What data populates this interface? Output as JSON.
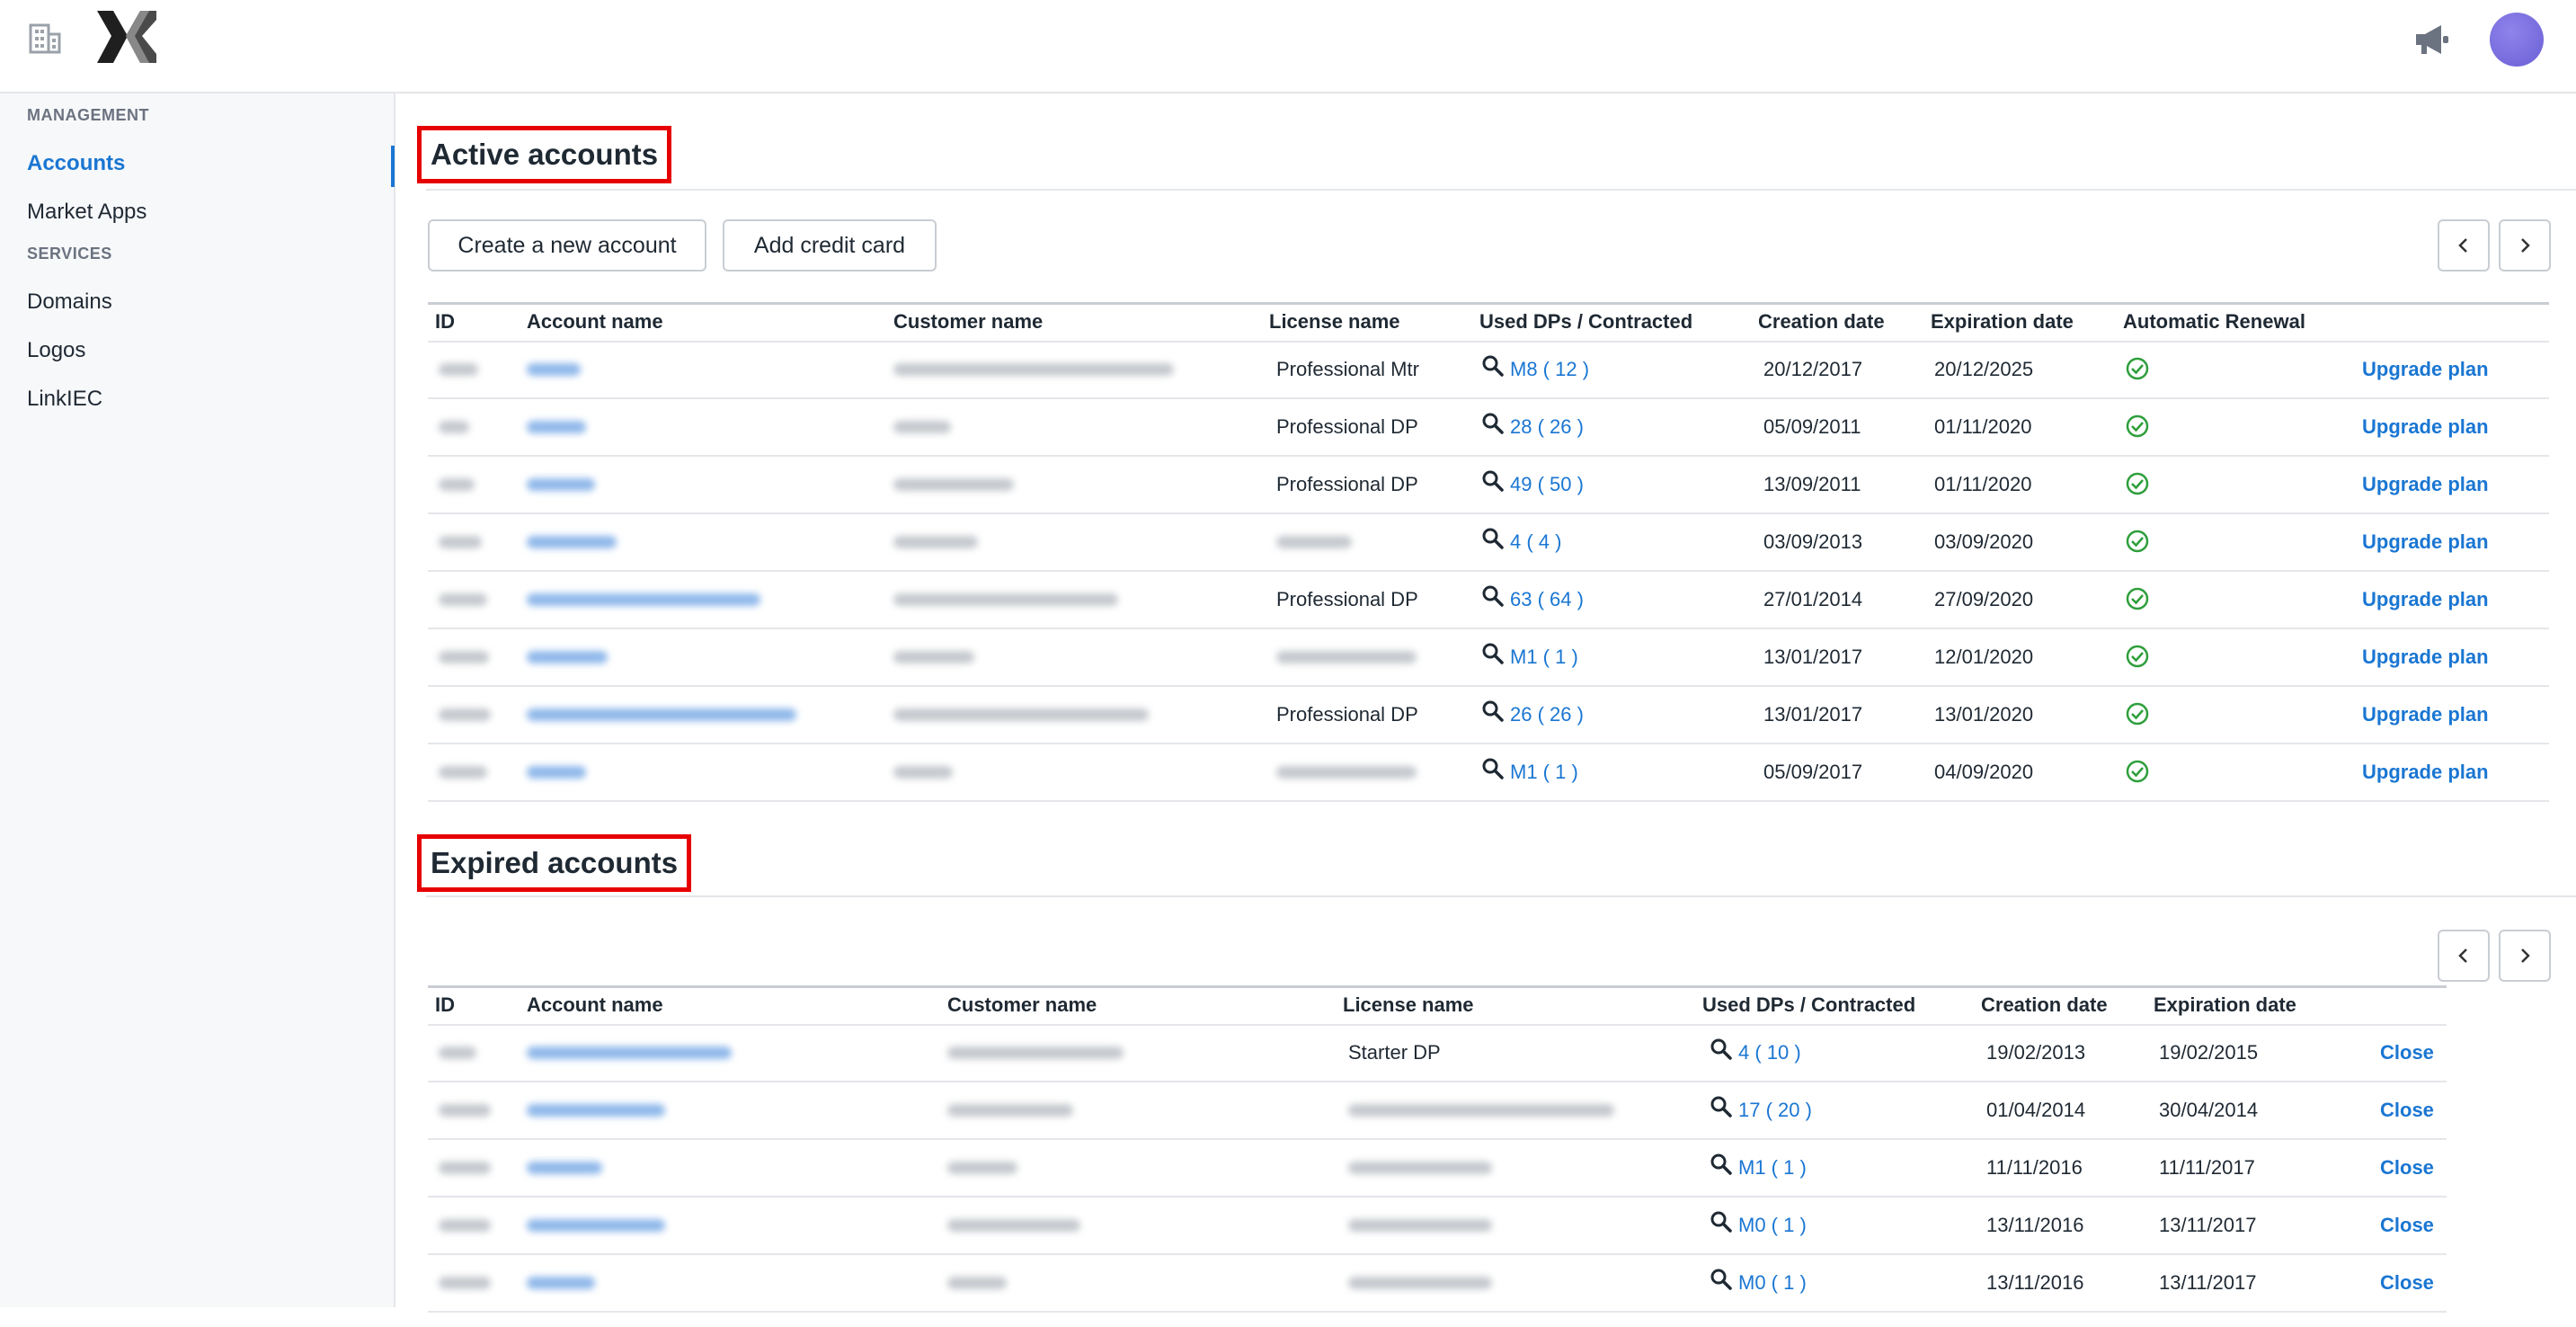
{
  "sidebar": {
    "management_heading": "MANAGEMENT",
    "services_heading": "SERVICES",
    "items": [
      "Accounts",
      "Market Apps",
      "Domains",
      "Logos",
      "LinkIEC"
    ]
  },
  "active": {
    "title": "Active accounts",
    "buttons": {
      "create": "Create a new account",
      "add_card": "Add credit card"
    },
    "headers": [
      "ID",
      "Account name",
      "Customer name",
      "License name",
      "Used DPs / Contracted",
      "Creation date",
      "Expiration date",
      "Automatic Renewal"
    ],
    "rows": [
      {
        "license": "Professional Mtr",
        "used": "M8 ( 12 )",
        "created": "20/12/2017",
        "expires": "20/12/2025",
        "action": "Upgrade plan"
      },
      {
        "license": "Professional DP",
        "used": "28 ( 26 )",
        "created": "05/09/2011",
        "expires": "01/11/2020",
        "action": "Upgrade plan"
      },
      {
        "license": "Professional DP",
        "used": "49 ( 50 )",
        "created": "13/09/2011",
        "expires": "01/11/2020",
        "action": "Upgrade plan"
      },
      {
        "license": "",
        "used": "4 ( 4 )",
        "created": "03/09/2013",
        "expires": "03/09/2020",
        "action": "Upgrade plan"
      },
      {
        "license": "Professional DP",
        "used": "63 ( 64 )",
        "created": "27/01/2014",
        "expires": "27/09/2020",
        "action": "Upgrade plan"
      },
      {
        "license": "",
        "used": "M1 ( 1 )",
        "created": "13/01/2017",
        "expires": "12/01/2020",
        "action": "Upgrade plan"
      },
      {
        "license": "Professional DP",
        "used": "26 ( 26 )",
        "created": "13/01/2017",
        "expires": "13/01/2020",
        "action": "Upgrade plan"
      },
      {
        "license": "",
        "used": "M1 ( 1 )",
        "created": "05/09/2017",
        "expires": "04/09/2020",
        "action": "Upgrade plan"
      }
    ]
  },
  "expired": {
    "title": "Expired accounts",
    "headers": [
      "ID",
      "Account name",
      "Customer name",
      "License name",
      "Used DPs / Contracted",
      "Creation date",
      "Expiration date"
    ],
    "rows": [
      {
        "license": "Starter DP",
        "used": "4 ( 10 )",
        "created": "19/02/2013",
        "expires": "19/02/2015",
        "action": "Close"
      },
      {
        "license": "",
        "used": "17 ( 20 )",
        "created": "01/04/2014",
        "expires": "30/04/2014",
        "action": "Close"
      },
      {
        "license": "",
        "used": "M1 ( 1 )",
        "created": "11/11/2016",
        "expires": "11/11/2017",
        "action": "Close"
      },
      {
        "license": "",
        "used": "M0 ( 1 )",
        "created": "13/11/2016",
        "expires": "13/11/2017",
        "action": "Close"
      },
      {
        "license": "",
        "used": "M0 ( 1 )",
        "created": "13/11/2016",
        "expires": "13/11/2017",
        "action": "Close"
      }
    ]
  },
  "colors": {
    "accent": "#1a76d2",
    "highlight_border": "#e60000",
    "success": "#2e9e3b"
  },
  "icons": [
    "building-icon",
    "logo",
    "megaphone-icon",
    "avatar",
    "search-icon",
    "check-circle-icon",
    "chevron-left-icon",
    "chevron-right-icon"
  ]
}
